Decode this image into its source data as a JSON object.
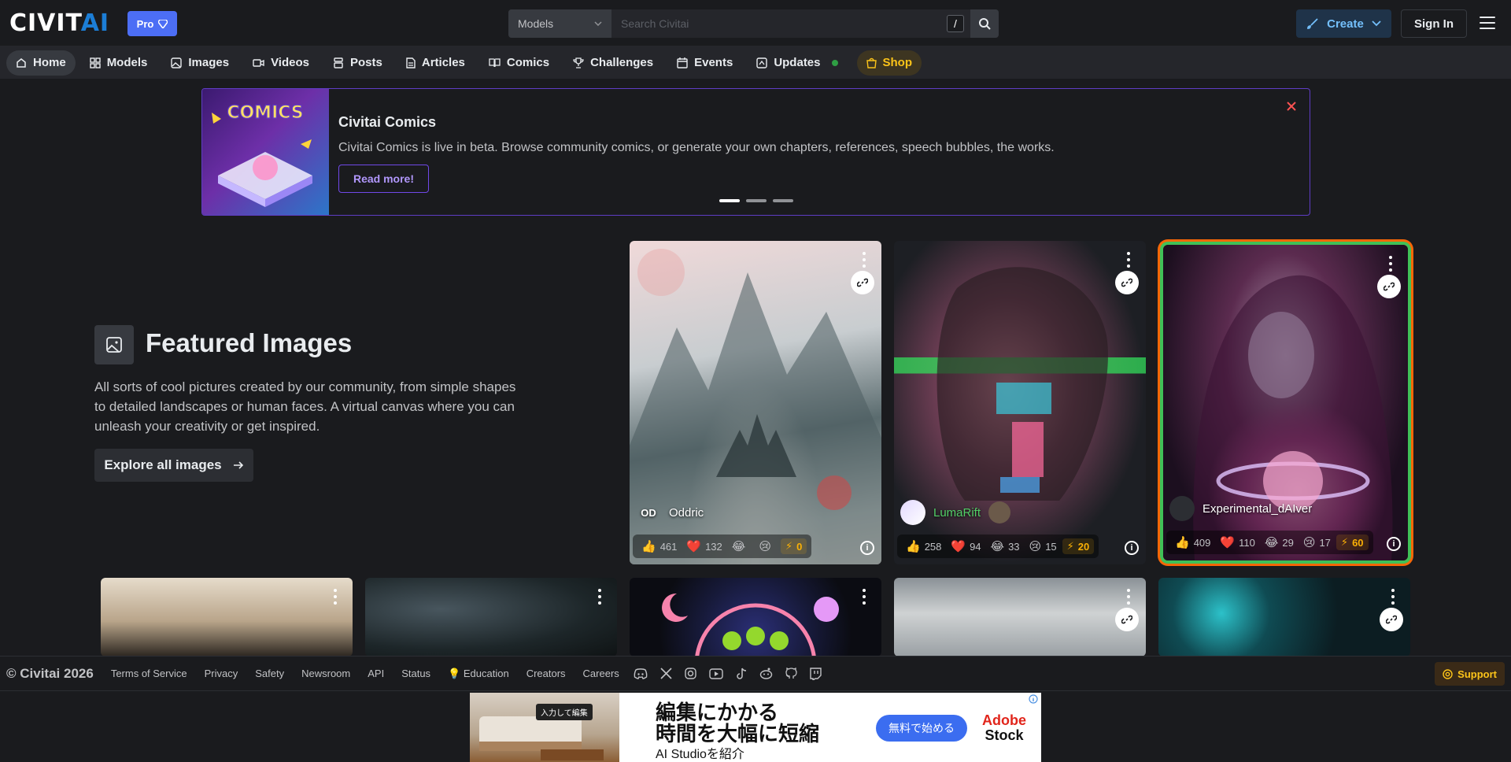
{
  "header": {
    "logo_main": "CIVIT",
    "logo_accent": "AI",
    "pro_label": "Pro",
    "search_scope": "Models",
    "search_placeholder": "Search Civitai",
    "search_shortcut": "/",
    "create_label": "Create",
    "signin_label": "Sign In"
  },
  "nav": {
    "items": [
      {
        "label": "Home",
        "icon": "home-icon",
        "active": true
      },
      {
        "label": "Models",
        "icon": "grid-icon"
      },
      {
        "label": "Images",
        "icon": "image-icon"
      },
      {
        "label": "Videos",
        "icon": "video-icon"
      },
      {
        "label": "Posts",
        "icon": "posts-icon"
      },
      {
        "label": "Articles",
        "icon": "article-icon"
      },
      {
        "label": "Comics",
        "icon": "book-icon"
      },
      {
        "label": "Challenges",
        "icon": "trophy-icon"
      },
      {
        "label": "Events",
        "icon": "calendar-icon"
      },
      {
        "label": "Updates",
        "icon": "updates-icon",
        "indicator_color": "#2f9e44"
      }
    ],
    "shop_label": "Shop",
    "shop_color": "#fcc419"
  },
  "banner": {
    "title": "Civitai Comics",
    "text": "Civitai Comics is live in beta. Browse community comics, or generate your own chapters, references, speech bubbles, the works.",
    "button_label": "Read more!",
    "art_text": "COMICS",
    "border_color": "#5f3dc4",
    "slide_count": 3,
    "active_slide": 1
  },
  "featured": {
    "title": "Featured Images",
    "description": "All sorts of cool pictures created by our community, from simple shapes to detailed landscapes or human faces. A virtual canvas where you can unleash your creativity or get inspired.",
    "button_label": "Explore all images"
  },
  "cards": [
    {
      "user": "Oddric",
      "avatar_initials": "OD",
      "likes": "461",
      "hearts": "132",
      "laughs": "",
      "cries": "",
      "buzz": "0"
    },
    {
      "user": "LumaRift",
      "likes": "258",
      "hearts": "94",
      "laughs": "33",
      "cries": "15",
      "buzz": "20"
    },
    {
      "user": "Experimental_dAIver",
      "likes": "409",
      "hearts": "110",
      "laughs": "29",
      "cries": "17",
      "buzz": "60",
      "highlight": true
    }
  ],
  "footer": {
    "copyright": "© Civitai 2026",
    "links": [
      "Terms of Service",
      "Privacy",
      "Safety",
      "Newsroom",
      "API",
      "Status",
      "💡 Education",
      "Creators",
      "Careers"
    ],
    "social_icons": [
      "discord-icon",
      "x-icon",
      "instagram-icon",
      "youtube-icon",
      "tiktok-icon",
      "reddit-icon",
      "github-icon",
      "twitch-icon"
    ],
    "support_label": "Support"
  },
  "ad": {
    "tag": "入力して編集",
    "headline_line1": "編集にかかる",
    "headline_line2": "時間を大幅に短縮",
    "sub": "AI Studioを紹介",
    "cta": "無料で始める",
    "brand_line1": "Adobe",
    "brand_line2": "Stock"
  }
}
